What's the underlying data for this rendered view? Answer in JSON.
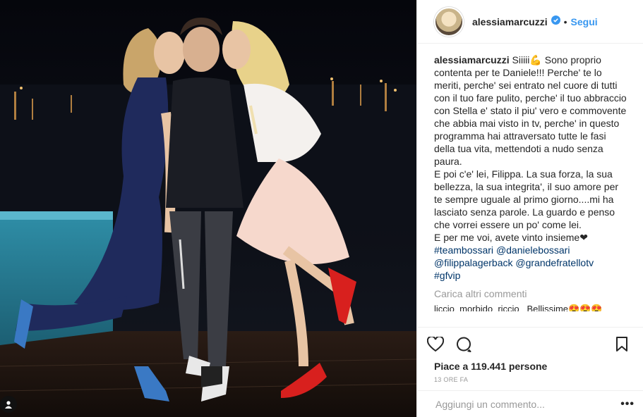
{
  "post": {
    "username": "alessiamarcuzzi",
    "follow_label": "Segui",
    "dot": "•",
    "caption_intro": "Siiiii💪 Sono proprio contenta per te Daniele!!! Perche' te lo meriti, perche' sei entrato nel cuore di tutti con il tuo fare pulito, perche' il tuo abbraccio con Stella e' stato il piu' vero e commovente che abbia mai visto in tv, perche' in questo programma hai attraversato tutte le fasi della tua vita, mettendoti a nudo senza paura.",
    "caption_p2": "E poi c'e' lei, Filippa. La sua forza, la sua bellezza, la sua integrita', il suo amore per te sempre uguale al primo giorno....mi ha lasciato senza parole. La guardo e penso che vorrei essere un po' come lei.",
    "caption_p3": "E per me voi, avete vinto insieme❤",
    "hashtags": [
      "#teambossari",
      "@danielebossari",
      "@filippalagerback",
      "@grandefratellotv",
      "#gfvip"
    ],
    "load_more": "Carica altri commenti",
    "next_comment": "liccio_morbido_riccio_ Bellissime😍😍😍",
    "likes": "Piace a 119.441 persone",
    "time": "13 ORE FA",
    "comment_placeholder": "Aggiungi un commento...",
    "more_options": "•••"
  },
  "colors": {
    "link": "#3897f0",
    "hashtag": "#003569",
    "text": "#262626",
    "muted": "#999999"
  },
  "icons": [
    "verified-badge-icon",
    "heart-icon",
    "comment-icon",
    "bookmark-icon",
    "user-tag-icon"
  ]
}
